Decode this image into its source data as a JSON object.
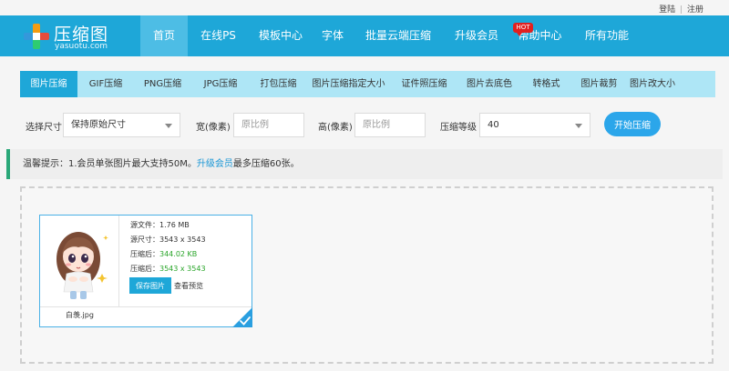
{
  "top_links": {
    "login": "登陆",
    "separator": "|",
    "register": "注册"
  },
  "logo": {
    "title": "压缩图",
    "subtitle": "yasuotu.com"
  },
  "nav": [
    {
      "label": "首页",
      "active": true
    },
    {
      "label": "在线PS"
    },
    {
      "label": "模板中心"
    },
    {
      "label": "字体"
    },
    {
      "label": "批量云端压缩"
    },
    {
      "label": "升级会员"
    },
    {
      "label": "帮助中心"
    },
    {
      "label": "所有功能"
    }
  ],
  "hot_badge": "HOT",
  "tabs": [
    {
      "label": "图片压缩",
      "active": true
    },
    {
      "label": "GIF压缩"
    },
    {
      "label": "PNG压缩"
    },
    {
      "label": "JPG压缩"
    },
    {
      "label": "打包压缩"
    },
    {
      "label": "图片压缩指定大小"
    },
    {
      "label": "证件照压缩"
    },
    {
      "label": "图片去底色"
    },
    {
      "label": "转格式"
    },
    {
      "label": "图片裁剪"
    },
    {
      "label": "图片改大小"
    }
  ],
  "settings": {
    "size_label": "选择尺寸",
    "size_value": "保持原始尺寸",
    "width_label": "宽(像素)",
    "width_placeholder": "原比例",
    "height_label": "高(像素)",
    "height_placeholder": "原比例",
    "level_label": "压缩等级",
    "level_value": "40",
    "start_button": "开始压缩"
  },
  "notice": {
    "prefix": "温馨提示：1.会员单张图片最大支持50M。",
    "link": "升级会员",
    "suffix": "最多压缩60张。"
  },
  "file_card": {
    "source_size": "源文件：1.76 MB",
    "source_dims": "源尺寸：3543 x 3543",
    "compressed_size_label": "压缩后：",
    "compressed_size": "344.02 KB",
    "compressed_dims_label": "压缩后：",
    "compressed_dims": "3543 x 3543",
    "save_button": "保存图片",
    "preview_link": "查看预览",
    "filename": "白羡.jpg"
  },
  "colors": {
    "brand": "#1ea7d8",
    "nav_active": "#4dbde5",
    "tab_bar": "#aee6f6",
    "start_button": "#2ba6ea",
    "notice_accent": "#2aa879",
    "success_text": "#2aa52a",
    "hot_badge": "#e02020"
  },
  "icons": {
    "logo": "plus-logo-icon",
    "dropdown": "chevron-down-icon",
    "selected": "check-corner-icon"
  }
}
